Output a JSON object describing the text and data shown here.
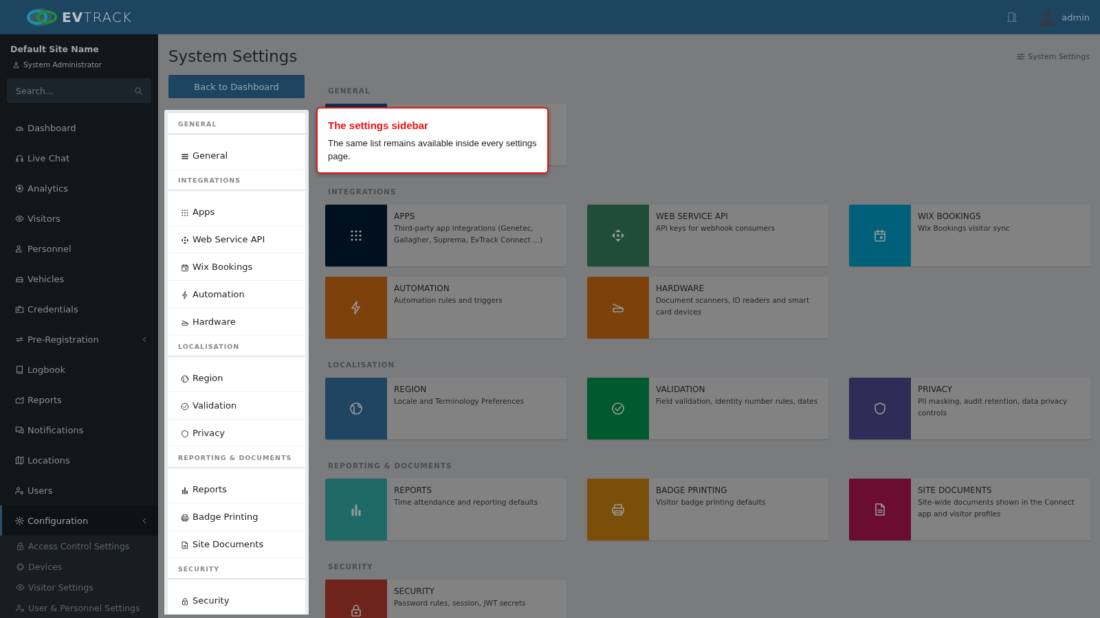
{
  "header": {
    "logo": "**EV**TRACK",
    "user": "admin"
  },
  "sidebar": {
    "site_name": "Default Site Name",
    "role": "System Administrator",
    "search": {
      "placeholder": "Search..."
    },
    "items": [
      {
        "label": "Dashboard",
        "expandable": false,
        "selected": false
      },
      {
        "label": "Live Chat",
        "expandable": false,
        "selected": false
      },
      {
        "label": "Analytics",
        "expandable": false,
        "selected": false
      },
      {
        "label": "Visitors",
        "expandable": false,
        "selected": false
      },
      {
        "label": "Personnel",
        "expandable": false,
        "selected": false
      },
      {
        "label": "Vehicles",
        "expandable": false,
        "selected": false
      },
      {
        "label": "Credentials",
        "expandable": false,
        "selected": false
      },
      {
        "label": "Pre-Registration",
        "expandable": true,
        "selected": false
      },
      {
        "label": "Logbook",
        "expandable": false,
        "selected": false
      },
      {
        "label": "Reports",
        "expandable": false,
        "selected": false
      },
      {
        "label": "Notifications",
        "expandable": false,
        "selected": false
      },
      {
        "label": "Locations",
        "expandable": false,
        "selected": false
      },
      {
        "label": "Users",
        "expandable": false,
        "selected": false
      },
      {
        "label": "Configuration",
        "expandable": true,
        "selected": true,
        "children": [
          {
            "label": "Access Control Settings"
          },
          {
            "label": "Devices"
          },
          {
            "label": "Visitor Settings"
          },
          {
            "label": "User & Personnel Settings"
          }
        ]
      }
    ]
  },
  "page": {
    "title": "System Settings",
    "breadcrumb": "System Settings",
    "back_button": "Back to Dashboard"
  },
  "settings_menu": {
    "sections": [
      {
        "heading": "GENERAL",
        "items": [
          {
            "label": "General"
          }
        ]
      },
      {
        "heading": "INTEGRATIONS",
        "items": [
          {
            "label": "Apps"
          },
          {
            "label": "Web Service API"
          },
          {
            "label": "Wix Bookings"
          },
          {
            "label": "Automation"
          },
          {
            "label": "Hardware"
          }
        ]
      },
      {
        "heading": "LOCALISATION",
        "items": [
          {
            "label": "Region"
          },
          {
            "label": "Validation"
          },
          {
            "label": "Privacy"
          }
        ]
      },
      {
        "heading": "REPORTING & DOCUMENTS",
        "items": [
          {
            "label": "Reports"
          },
          {
            "label": "Badge Printing"
          },
          {
            "label": "Site Documents"
          }
        ]
      },
      {
        "heading": "SECURITY",
        "items": [
          {
            "label": "Security"
          }
        ]
      }
    ]
  },
  "cards": {
    "sections": [
      {
        "heading": "GENERAL",
        "cards": [
          {
            "color": "#0d3150"
          }
        ]
      },
      {
        "heading": "INTEGRATIONS",
        "cards": [
          {
            "title": "APPS",
            "description": "Third-party app integrations (Genetec, Gallagher, Suprema, EvTrack Connect ...)",
            "color": "#00101f"
          },
          {
            "title": "WEB SERVICE API",
            "description": "API keys for webhook consumers",
            "color": "#1f4d38"
          },
          {
            "title": "WIX BOOKINGS",
            "description": "Wix Bookings visitor sync",
            "color": "#00607a"
          },
          {
            "title": "AUTOMATION",
            "description": "Automation rules and triggers",
            "color": "#7d410c"
          },
          {
            "title": "HARDWARE",
            "description": "Document scanners, ID readers and smart card devices",
            "color": "#7d410c"
          }
        ]
      },
      {
        "heading": "LOCALISATION",
        "cards": [
          {
            "title": "REGION",
            "description": "Locale and Terminology Preferences",
            "color": "#1f4562"
          },
          {
            "title": "VALIDATION",
            "description": "Field validation, identity number rules, dates",
            "color": "#005a2e"
          },
          {
            "title": "PRIVACY",
            "description": "PII masking, audit retention, data privacy controls",
            "color": "#302c57"
          }
        ]
      },
      {
        "heading": "REPORTING & DOCUMENTS",
        "cards": [
          {
            "title": "REPORTS",
            "description": "Time attendance and reporting defaults",
            "color": "#1f6a66"
          },
          {
            "title": "BADGE PRINTING",
            "description": "Visitor badge printing defaults",
            "color": "#7a4f0a"
          },
          {
            "title": "SITE DOCUMENTS",
            "description": "Site-wide documents shown in the Connect app and visitor profiles",
            "color": "#6b0d2e"
          }
        ]
      },
      {
        "heading": "SECURITY",
        "cards": [
          {
            "title": "SECURITY",
            "description": "Password rules, session, JWT secrets",
            "color": "#6e231b"
          }
        ]
      }
    ]
  },
  "tooltip": {
    "title": "The settings sidebar",
    "text": "The same list remains available inside every settings page."
  }
}
